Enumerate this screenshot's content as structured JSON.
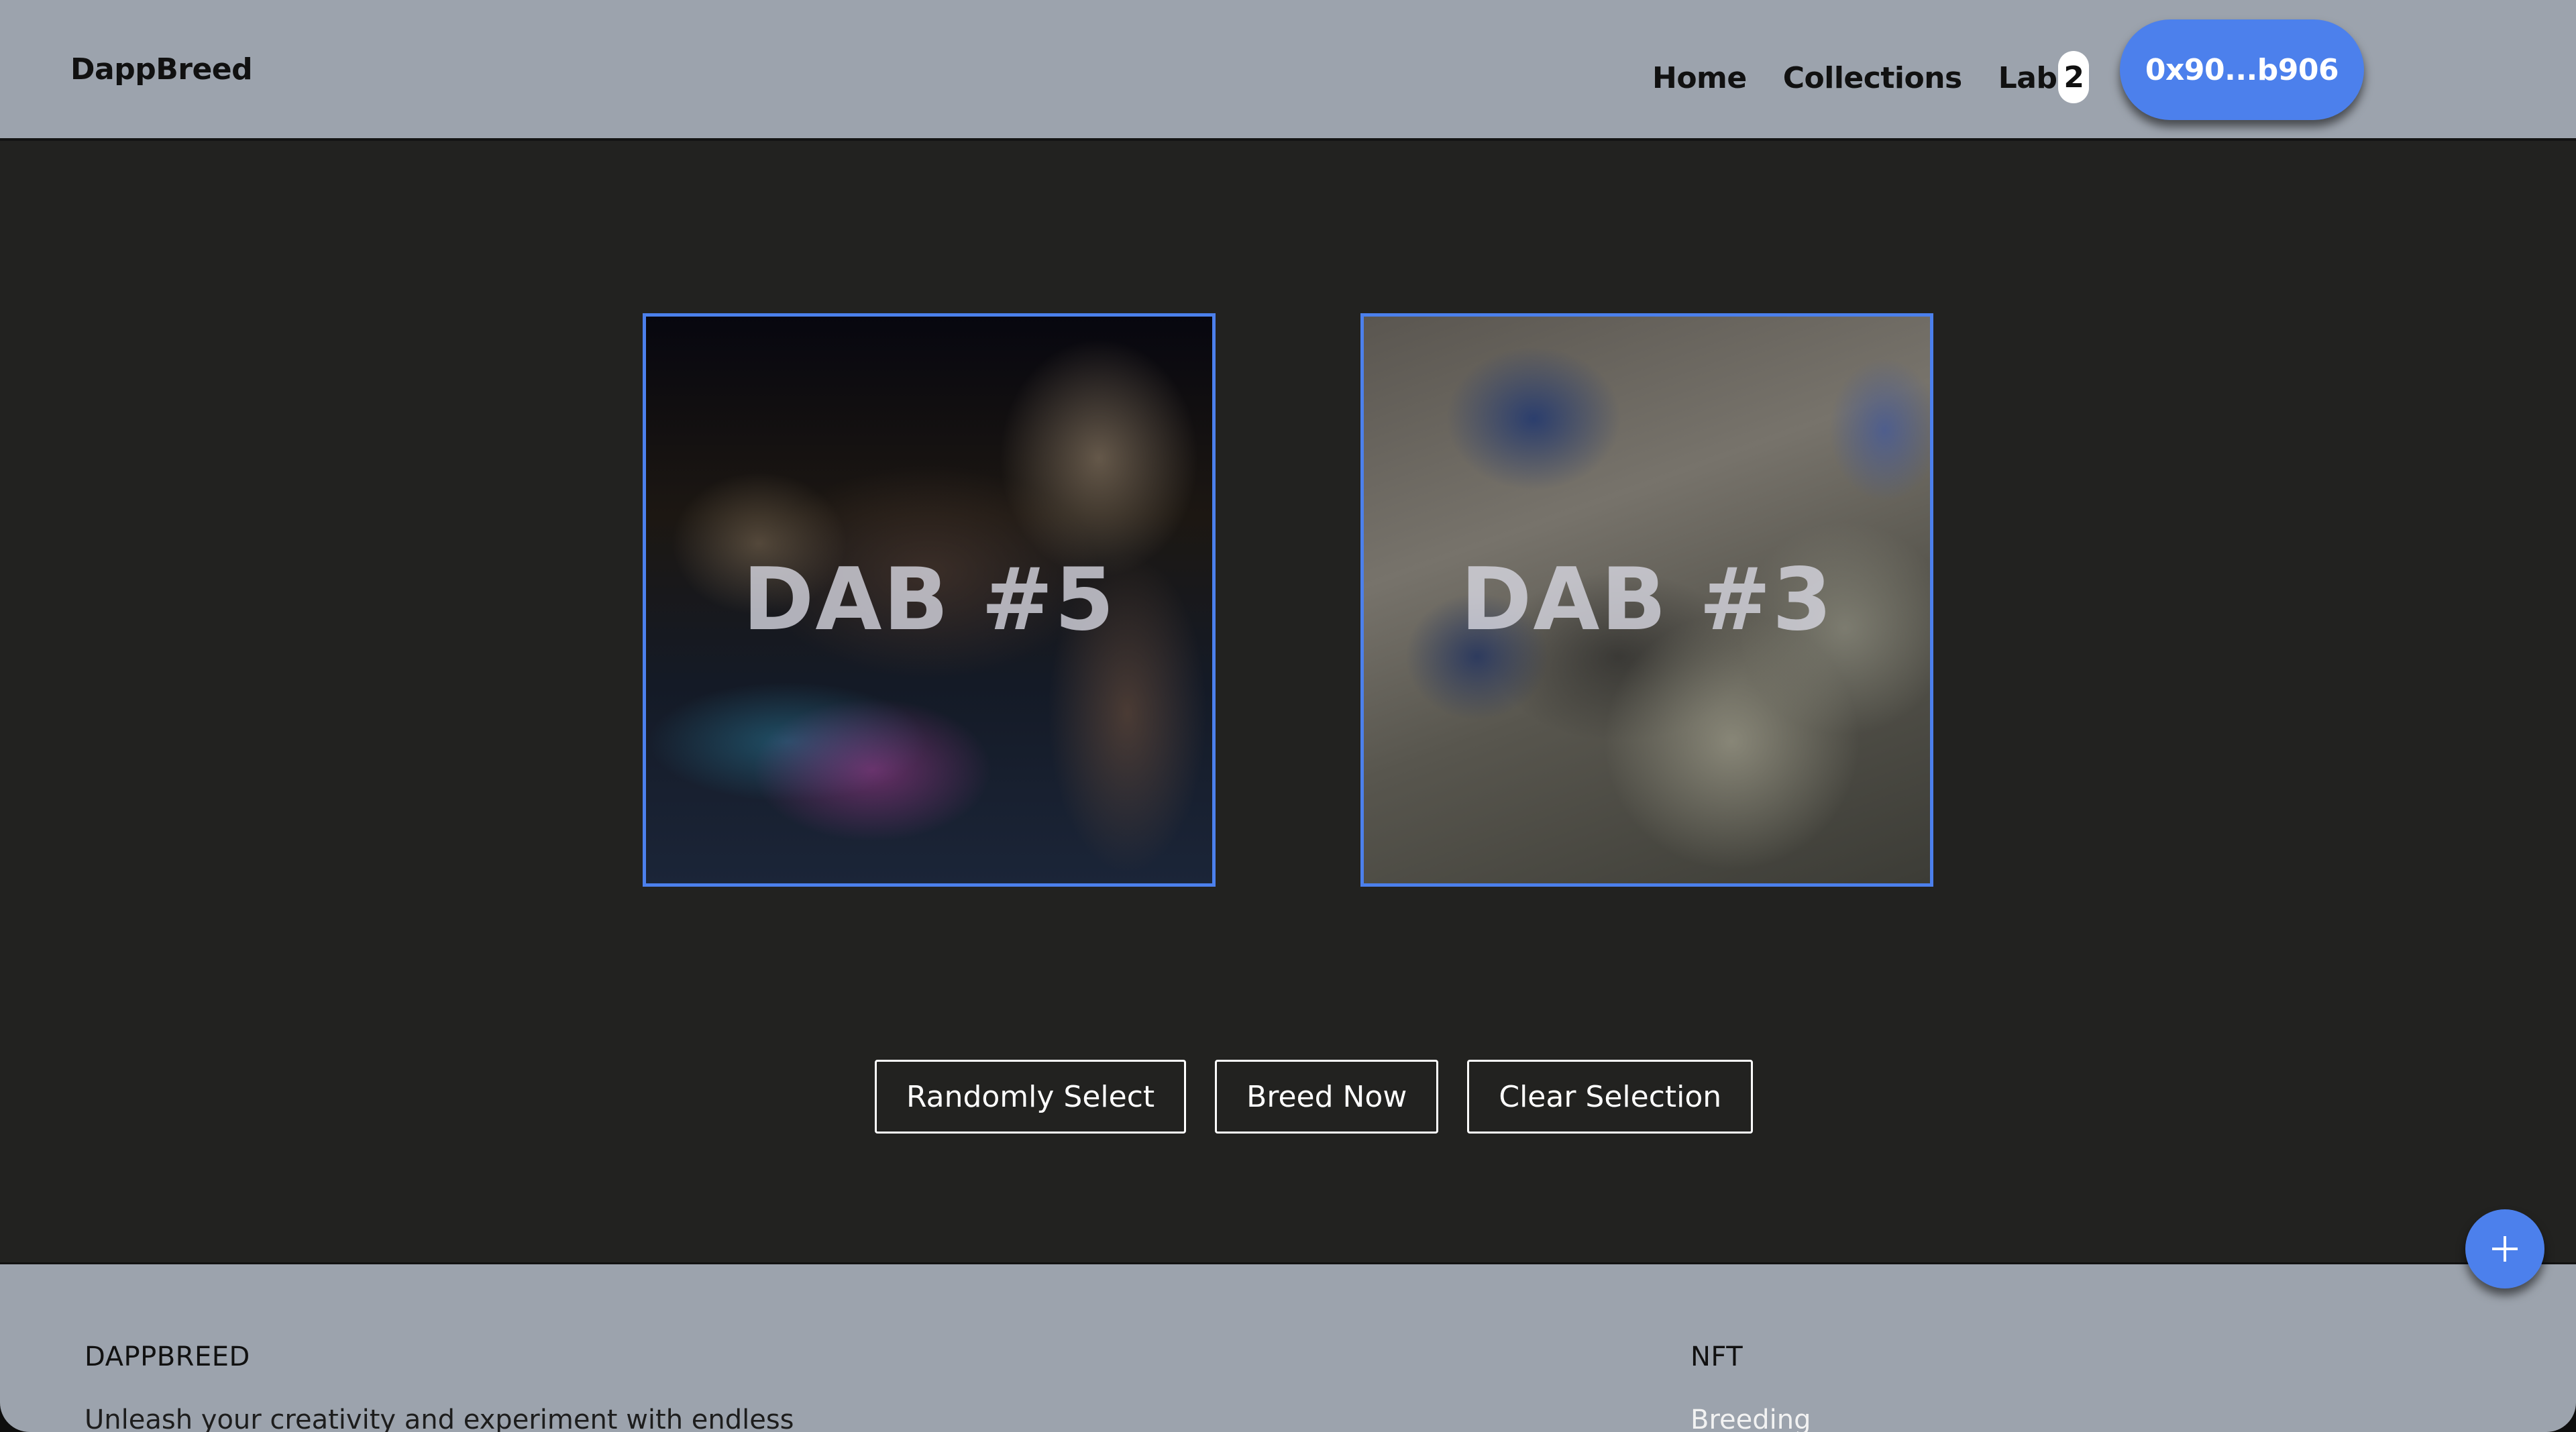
{
  "header": {
    "brand": "DappBreed",
    "nav": [
      {
        "label": "Home"
      },
      {
        "label": "Collections"
      },
      {
        "label": "Lab",
        "badge": "2"
      }
    ],
    "wallet_label": "0x90...b906"
  },
  "main": {
    "selected_cards": [
      {
        "label": "DAB #5",
        "selected": true
      },
      {
        "label": "DAB #3",
        "selected": true
      }
    ],
    "actions": {
      "random_label": "Randomly Select",
      "breed_label": "Breed Now",
      "clear_label": "Clear Selection"
    }
  },
  "fab": {
    "icon": "plus-icon"
  },
  "footer": {
    "col1": {
      "heading": "DAPPBREED",
      "text": "Unleash your creativity and experiment with endless"
    },
    "col2": {
      "heading": "NFT",
      "links": [
        "Breeding"
      ]
    }
  },
  "colors": {
    "accent": "#4c80ec",
    "header_bg": "#9ca3ad",
    "main_bg": "#222220"
  }
}
